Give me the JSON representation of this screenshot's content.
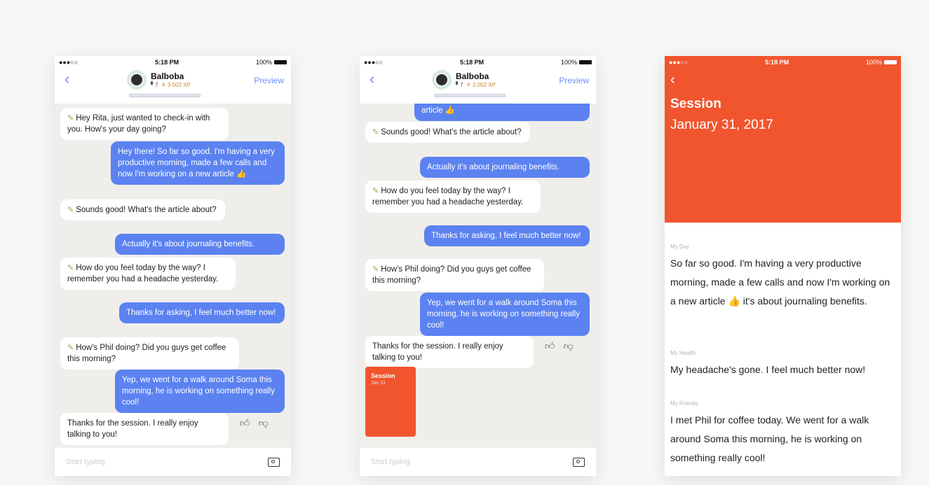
{
  "status": {
    "time": "5:18 PM",
    "battery": "100%",
    "signal": "●●●○○"
  },
  "header": {
    "name": "Balboba",
    "level": "▘7",
    "xp": "⚘ 3 002 XP",
    "back_icon": "chevron-left-icon",
    "preview_label": "Preview"
  },
  "phone1_messages": [
    {
      "dir": "in",
      "text": "Hey Rita, just wanted to check-in with you. How's your day going?"
    },
    {
      "dir": "out",
      "text": "Hey there! So far so good. I'm having a very productive morning, made a few calls and now I'm working on a new article 👍"
    },
    {
      "dir": "in",
      "text": "Sounds good! What's the article about?"
    },
    {
      "dir": "out",
      "text": "Actually it's about journaling benefits."
    },
    {
      "dir": "in",
      "text": "How do you feel today by the way? I remember you had a headache yesterday."
    },
    {
      "dir": "out",
      "text": "Thanks for asking, I feel much better now!"
    },
    {
      "dir": "in",
      "text": "How's Phil doing? Did you guys get coffee this morning?"
    },
    {
      "dir": "out",
      "text": "Yep, we went for a walk around Soma this morning, he is working on something really cool!"
    },
    {
      "dir": "in",
      "text": "Thanks for the session. I really enjoy talking to you!"
    }
  ],
  "phone2_messages": [
    {
      "dir": "out",
      "text": "article 👍"
    },
    {
      "dir": "in",
      "text": "Sounds good! What's the article about?"
    },
    {
      "dir": "out",
      "text": "Actually it's about journaling benefits."
    },
    {
      "dir": "in",
      "text": "How do you feel today by the way? I remember you had a headache yesterday."
    },
    {
      "dir": "out",
      "text": "Thanks for asking, I feel much better now!"
    },
    {
      "dir": "in",
      "text": "How's Phil doing? Did you guys get coffee this morning?"
    },
    {
      "dir": "out",
      "text": "Yep, we went for a walk around Soma this morning, he is working on something really cool!"
    },
    {
      "dir": "in",
      "text": "Thanks for the session. I really enjoy talking to you!"
    }
  ],
  "input": {
    "placeholder": "Start typing"
  },
  "session_card": {
    "title": "Session",
    "date": "Jan 31"
  },
  "session_page": {
    "title": "Session",
    "date": "January 31, 2017",
    "entries": [
      {
        "label": "My Day",
        "text": "So far so good. I'm having a very productive morning, made a few calls and now I'm working on a new article 👍 it's about journaling benefits."
      },
      {
        "label": "My Health",
        "text": "My headache's gone. I feel much better now!"
      },
      {
        "label": "My Friends",
        "text": "I met Phil for coffee today. We went for a walk around Soma this morning, he is working on something really cool!"
      }
    ]
  },
  "colors": {
    "accent": "#5b82f0",
    "session": "#f1552e",
    "chat_bg": "#efeeea"
  }
}
